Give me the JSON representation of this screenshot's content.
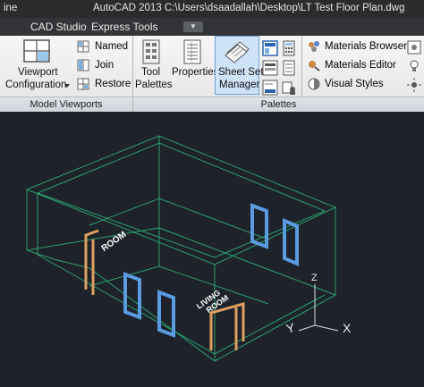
{
  "titlebar": {
    "left_text": "ine",
    "title": "AutoCAD 2013    C:\\Users\\dsaadallah\\Desktop\\LT Test Floor Plan.dwg"
  },
  "tabs": {
    "cad_studio": "CAD Studio",
    "express_tools": "Express Tools",
    "extra": "▼"
  },
  "ribbon": {
    "viewport_config": {
      "line1": "Viewport",
      "line2": "Configuration"
    },
    "named": "Named",
    "join": "Join",
    "restore": "Restore",
    "tool_palettes": {
      "line1": "Tool",
      "line2": "Palettes"
    },
    "properties": "Properties",
    "sheet_set_manager": {
      "line1": "Sheet Set",
      "line2": "Manager"
    },
    "materials_browser": "Materials Browser",
    "materials_editor": "Materials Editor",
    "visual_styles": "Visual Styles",
    "panel_model_viewports": "Model Viewports",
    "panel_palettes": "Palettes"
  },
  "drawing": {
    "room_label_1": "ROOM",
    "room_label_2_line1": "LIVING",
    "room_label_2_line2": "ROOM",
    "axis_z": "Z",
    "axis_x": "X",
    "axis_y": "Y",
    "colors": {
      "wall": "#2f9e6a",
      "window": "#5b9be0",
      "door": "#e0a060",
      "background": "#1d222b"
    }
  }
}
